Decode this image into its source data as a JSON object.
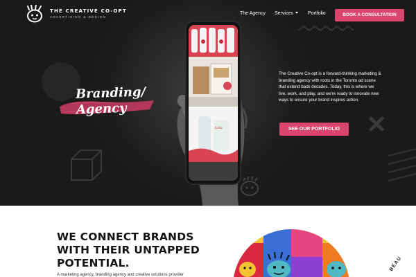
{
  "brand": {
    "title": "THE CREATIVE CO-OPT",
    "subtitle": "ADVERTISING & DESIGN"
  },
  "nav": {
    "items": [
      {
        "label": "The Agency"
      },
      {
        "label": "Services"
      },
      {
        "label": "Portfolio"
      }
    ],
    "cta_label": "BOOK A CONSULTATION"
  },
  "hero": {
    "script_line1": "Branding/",
    "script_line2": "Agency",
    "body": "The Creative Co-opt is a forward-thinking marketing & branding agency with roots in the Toronto ad scene that extend back decades. Today, this is where we live, work, and play, and we're ready to innovate new ways to ensure your brand inspires action.",
    "button_label": "SEE OUR PORTFOLIO"
  },
  "section": {
    "headline_lines": [
      "WE CONNECT BRANDS",
      "WITH THEIR UNTAPPED",
      "POTENTIAL."
    ],
    "paragraph_partial": "A marketing agency, branding agency and creative solutions provider",
    "curved_text": "BEAU"
  },
  "colors": {
    "accent": "#d9456d",
    "hero_bg": "#1a1a1a",
    "text_dark": "#141414"
  }
}
